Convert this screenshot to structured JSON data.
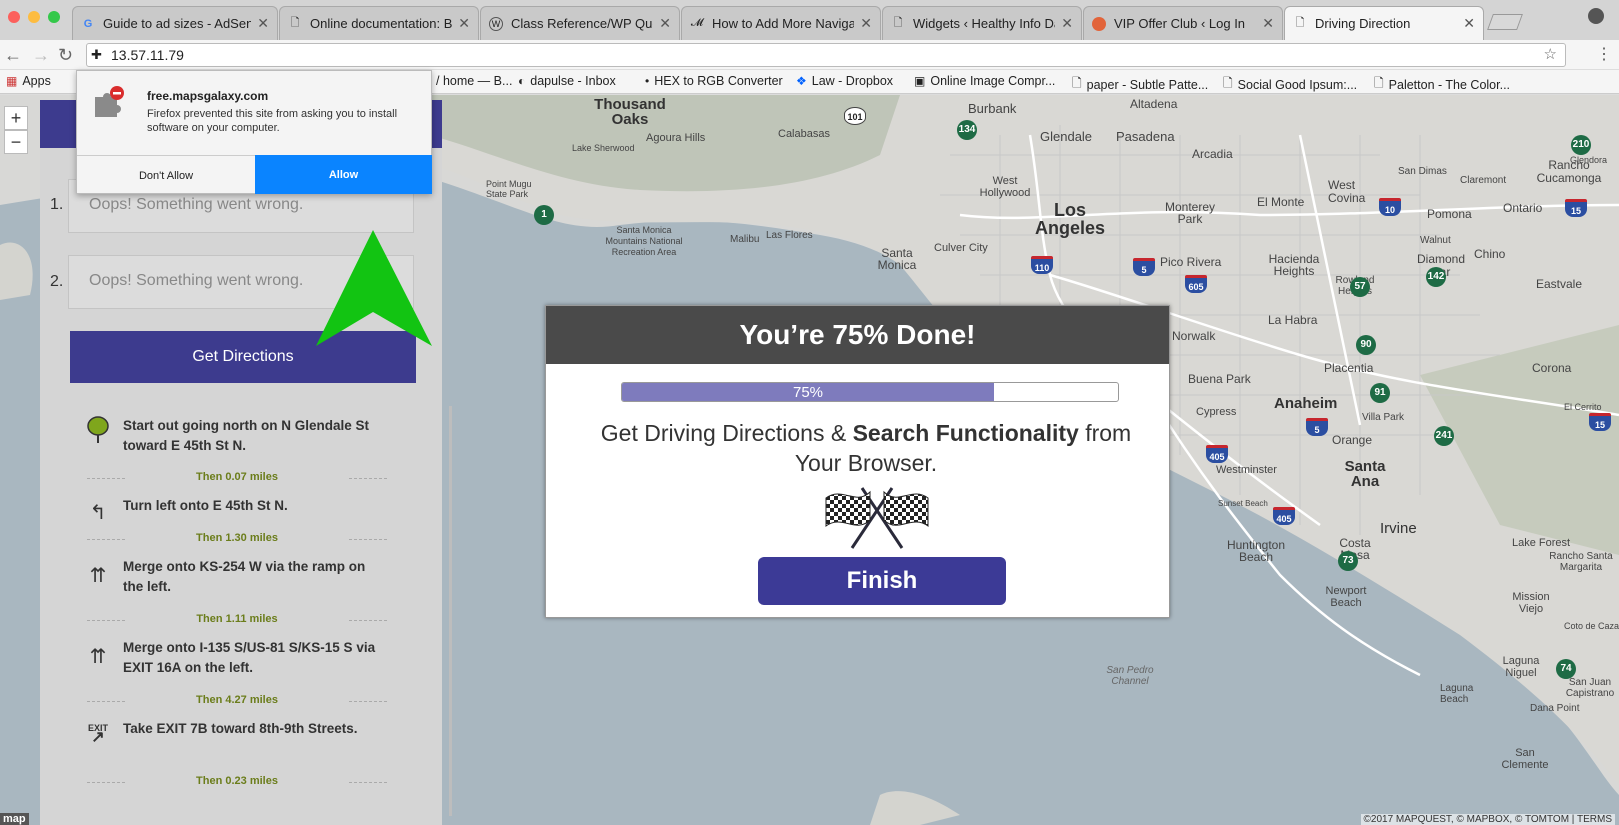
{
  "browser": {
    "tabs": [
      {
        "title": "Guide to ad sizes - AdSense",
        "icon": "google-icon"
      },
      {
        "title": "Online documentation: Butt",
        "icon": "page-icon"
      },
      {
        "title": "Class Reference/WP Query",
        "icon": "wordpress-icon"
      },
      {
        "title": "How to Add More Navigatio",
        "icon": "wpbeginner-icon"
      },
      {
        "title": "Widgets ‹ Healthy Info Daily",
        "icon": "page-icon"
      },
      {
        "title": "VIP Offer Club ‹ Log In",
        "icon": "orange-circle-icon"
      },
      {
        "title": "Driving Direction",
        "icon": "page-icon"
      }
    ],
    "url": "13.57.11.79",
    "bookmarks": [
      {
        "label": "Apps"
      },
      {
        "label": "/ home — B..."
      },
      {
        "label": "dapulse - Inbox"
      },
      {
        "label": "HEX to RGB Converter"
      },
      {
        "label": "Law - Dropbox"
      },
      {
        "label": "Online Image Compr..."
      },
      {
        "label": "paper - Subtle Patte..."
      },
      {
        "label": "Social Good Ipsum:..."
      },
      {
        "label": "Paletton - The Color..."
      }
    ]
  },
  "popup": {
    "host": "free.mapsgalaxy.com",
    "message": "Firefox prevented this site from asking you to install software on your computer.",
    "deny_label": "Don't Allow",
    "allow_label": "Allow"
  },
  "panel": {
    "inputs": [
      {
        "number": "1.",
        "value": "Oops! Something went wrong."
      },
      {
        "number": "2.",
        "value": "Oops! Something went wrong."
      }
    ],
    "get_directions_label": "Get Directions",
    "steps": [
      {
        "icon": "start-pin-icon",
        "text": "Start out going north on N Glendale St toward E 45th St N.",
        "then": "Then 0.07 miles"
      },
      {
        "icon": "turn-left-icon",
        "text": "Turn left onto E 45th St N.",
        "then": "Then 1.30 miles"
      },
      {
        "icon": "merge-icon",
        "text": "Merge onto KS-254 W via the ramp on the left.",
        "then": "Then 1.11 miles"
      },
      {
        "icon": "merge-icon",
        "text": "Merge onto I-135 S/US-81 S/KS-15 S via EXIT 16A on the left.",
        "then": "Then 4.27 miles"
      },
      {
        "icon": "exit-icon",
        "text": "Take EXIT 7B toward 8th-9th Streets.",
        "then": "Then 0.23 miles"
      }
    ]
  },
  "modal": {
    "title": "You’re 75% Done!",
    "progress_label": "75%",
    "progress_value": 0.75,
    "text_part1": "Get Driving Directions & ",
    "text_bold": "Search Functionality",
    "text_part2": " from Your Browser.",
    "finish_label": "Finish"
  },
  "map": {
    "labels": [
      "Thousand Oaks",
      "Burbank",
      "Altadena",
      "Glendale",
      "Pasadena",
      "Arcadia",
      "Calabasas",
      "Agoura Hills",
      "Lake Sherwood",
      "Point Mugu State Park",
      "Santa Monica Mountains National Recreation Area",
      "Malibu",
      "Las Flores",
      "West Hollywood",
      "Culver City",
      "Santa Monica",
      "Los Angeles",
      "Monterey Park",
      "El Monte",
      "West Covina",
      "Pomona",
      "Ontario",
      "Rancho Cucamonga",
      "Claremont",
      "San Dimas",
      "Walnut",
      "Chino",
      "Pico Rivera",
      "Hacienda Heights",
      "Rowland Heights",
      "Diamond Bar",
      "Eastvale",
      "Norwalk",
      "La Habra",
      "Buena Park",
      "Placentia",
      "Corona",
      "Anaheim",
      "Cypress",
      "Villa Park",
      "Orange",
      "Westminster",
      "Santa Ana",
      "Huntington Beach",
      "Irvine",
      "Costa Mesa",
      "Newport Beach",
      "Lake Forest",
      "Rancho Santa Margarita",
      "Mission Viejo",
      "Laguna Niguel",
      "San Juan Capistrano",
      "Dana Point",
      "San Clemente",
      "El Cerrito",
      "Coto de Caza",
      "Laguna Beach",
      "San Pedro Channel",
      "Sunset Beach",
      "Glendora"
    ],
    "copyright": "©2017 MAPQUEST, © MAPBOX, © TOMTOM | TERMS",
    "logo": "map",
    "zoom_in": "+",
    "zoom_out": "−"
  },
  "colors": {
    "accent": "#3d3b8e",
    "progress": "#7e7bbd",
    "allow_button": "#0a84ff",
    "arrow": "#12c412"
  }
}
